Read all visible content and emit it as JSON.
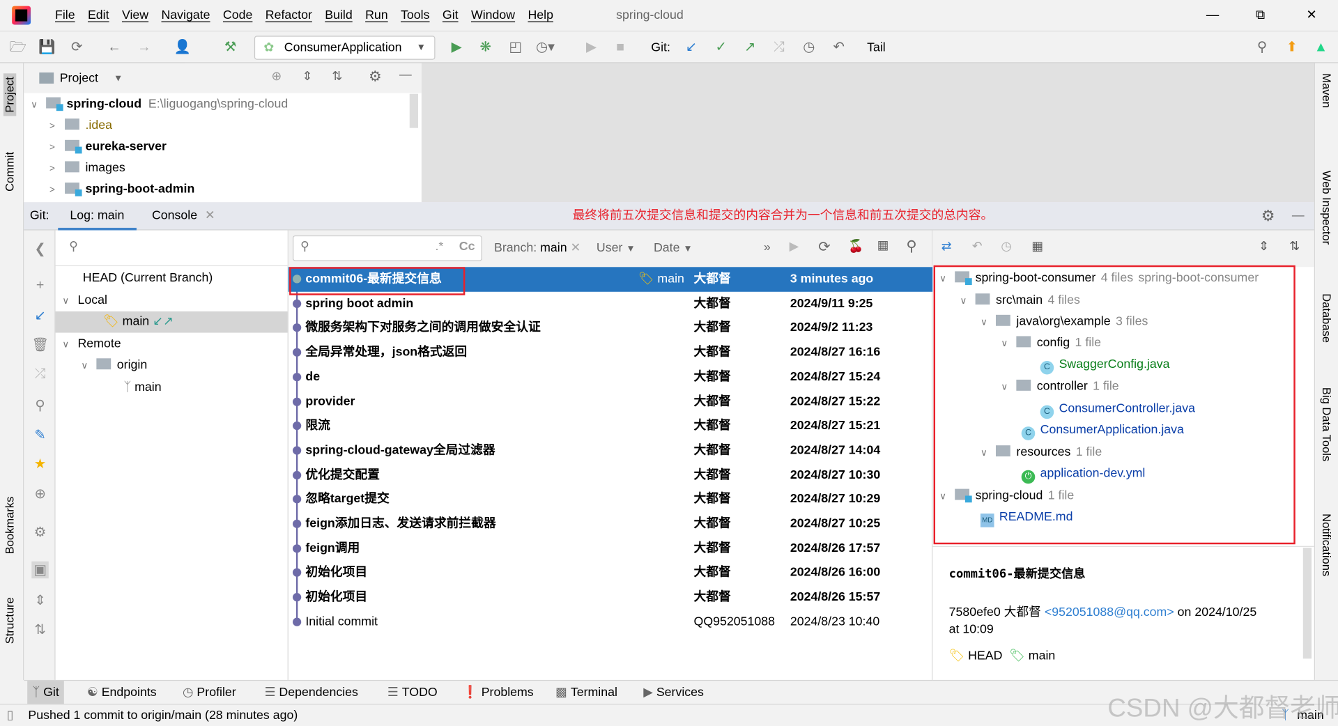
{
  "window": {
    "title": "spring-cloud",
    "menu": [
      "File",
      "Edit",
      "View",
      "Navigate",
      "Code",
      "Refactor",
      "Build",
      "Run",
      "Tools",
      "Git",
      "Window",
      "Help"
    ]
  },
  "toolbar": {
    "run_config": "ConsumerApplication",
    "git_label": "Git:",
    "tail_label": "Tail"
  },
  "left_strip": {
    "project": "Project",
    "commit": "Commit",
    "bookmarks": "Bookmarks",
    "structure": "Structure"
  },
  "right_strip": {
    "maven": "Maven",
    "web_inspector": "Web Inspector",
    "database": "Database",
    "big_data_tools": "Big Data Tools",
    "notifications": "Notifications"
  },
  "project": {
    "header": "Project",
    "items": [
      {
        "name": "spring-cloud",
        "path": "E:\\liguogang\\spring-cloud"
      },
      {
        "name": ".idea"
      },
      {
        "name": "eureka-server"
      },
      {
        "name": "images"
      },
      {
        "name": "spring-boot-admin"
      }
    ]
  },
  "git_window": {
    "label": "Git:",
    "tabs": [
      "Log: main",
      "Console"
    ],
    "annotation": "最终将前五次提交信息和提交的内容合并为一个信息和前五次提交的总内容。"
  },
  "branches": {
    "head": "HEAD (Current Branch)",
    "local": "Local",
    "local_main": "main",
    "remote": "Remote",
    "origin": "origin",
    "origin_main": "main"
  },
  "log_toolbar": {
    "regex": ".*",
    "case": "Cc",
    "branch_label": "Branch:",
    "branch_value": "main",
    "user": "User",
    "date": "Date",
    "more": "»"
  },
  "commits": [
    {
      "message": "commit06-最新提交信息",
      "ref": "main",
      "author": "大都督",
      "date": "3 minutes ago"
    },
    {
      "message": "spring boot admin",
      "author": "大都督",
      "date": "2024/9/11 9:25"
    },
    {
      "message": "微服务架构下对服务之间的调用做安全认证",
      "author": "大都督",
      "date": "2024/9/2 11:23"
    },
    {
      "message": "全局异常处理，json格式返回",
      "author": "大都督",
      "date": "2024/8/27 16:16"
    },
    {
      "message": "de",
      "author": "大都督",
      "date": "2024/8/27 15:24"
    },
    {
      "message": "provider",
      "author": "大都督",
      "date": "2024/8/27 15:22"
    },
    {
      "message": "限流",
      "author": "大都督",
      "date": "2024/8/27 15:21"
    },
    {
      "message": "spring-cloud-gateway全局过滤器",
      "author": "大都督",
      "date": "2024/8/27 14:04"
    },
    {
      "message": "优化提交配置",
      "author": "大都督",
      "date": "2024/8/27 10:30"
    },
    {
      "message": "忽略target提交",
      "author": "大都督",
      "date": "2024/8/27 10:29"
    },
    {
      "message": "feign添加日志、发送请求前拦截器",
      "author": "大都督",
      "date": "2024/8/27 10:25"
    },
    {
      "message": "feign调用",
      "author": "大都督",
      "date": "2024/8/26 17:57"
    },
    {
      "message": "初始化项目",
      "author": "大都督",
      "date": "2024/8/26 16:00"
    },
    {
      "message": "初始化项目",
      "author": "大都督",
      "date": "2024/8/26 15:57"
    },
    {
      "message": "Initial commit",
      "author": "QQ952051088",
      "date": "2024/8/23 10:40"
    }
  ],
  "changes": [
    {
      "name": "spring-boot-consumer",
      "count": "4 files",
      "extra": "spring-boot-consumer"
    },
    {
      "name": "src\\main",
      "count": "4 files"
    },
    {
      "name": "java\\org\\example",
      "count": "3 files"
    },
    {
      "name": "config",
      "count": "1 file"
    },
    {
      "name": "SwaggerConfig.java"
    },
    {
      "name": "controller",
      "count": "1 file"
    },
    {
      "name": "ConsumerController.java"
    },
    {
      "name": "ConsumerApplication.java"
    },
    {
      "name": "resources",
      "count": "1 file"
    },
    {
      "name": "application-dev.yml"
    },
    {
      "name": "spring-cloud",
      "count": "1 file"
    },
    {
      "name": "README.md"
    }
  ],
  "commit_details": {
    "title": "commit06-最新提交信息",
    "hash": "7580efe0",
    "author": "大都督",
    "email": "<952051088@qq.com>",
    "on": "on 2024/10/25",
    "at": "at 10:09",
    "refs": [
      "HEAD",
      "main"
    ]
  },
  "bottom_tabs": [
    "Git",
    "Endpoints",
    "Profiler",
    "Dependencies",
    "TODO",
    "Problems",
    "Terminal",
    "Services"
  ],
  "status": {
    "message": "Pushed 1 commit to origin/main (28 minutes ago)",
    "branch": "main"
  },
  "watermark": "CSDN @大都督老师",
  "colors": {
    "selection": "#2675bf",
    "annotation": "#e8202a",
    "added_file": "#067d17",
    "modified_file": "#0a3ea8"
  }
}
